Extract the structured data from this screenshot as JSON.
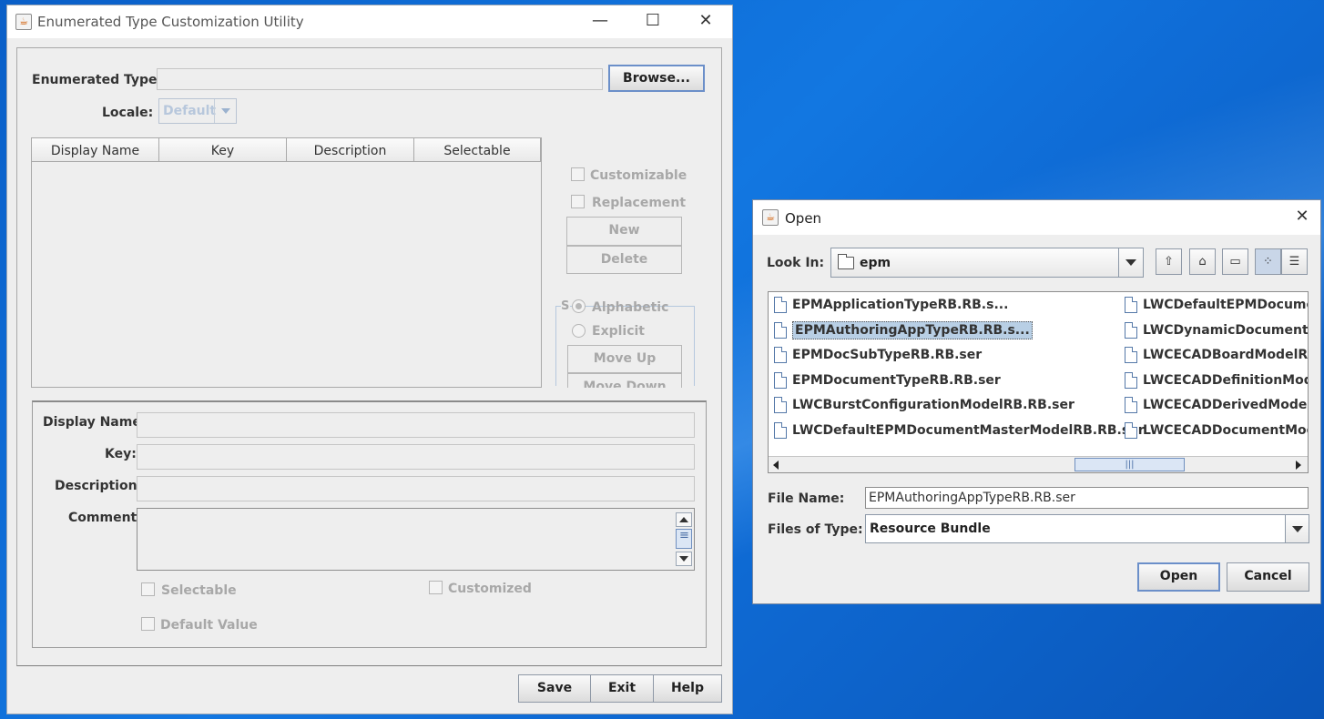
{
  "main_window": {
    "title": "Enumerated Type Customization Utility",
    "enumerated_type_label": "Enumerated Type:",
    "enumerated_type_value": "",
    "browse_label": "Browse...",
    "locale_label": "Locale:",
    "locale_value": "Default",
    "table_headers": [
      "Display Name",
      "Key",
      "Description",
      "Selectable"
    ],
    "customizable_label": "Customizable",
    "replacement_label": "Replacement",
    "new_label": "New",
    "delete_label": "Delete",
    "sort_group_label": "S",
    "alphabetic_label": "Alphabetic",
    "explicit_label": "Explicit",
    "move_up_label": "Move Up",
    "move_down_label": "Move Down",
    "display_name_label": "Display Name:",
    "key_label": "Key:",
    "description_label": "Description:",
    "comment_label": "Comment:",
    "selectable_label": "Selectable",
    "customized_label": "Customized",
    "default_value_label": "Default Value",
    "save_label": "Save",
    "exit_label": "Exit",
    "help_label": "Help"
  },
  "open_dialog": {
    "title": "Open",
    "look_in_label": "Look In:",
    "look_in_value": "epm",
    "files_col1": [
      "EPMApplicationTypeRB.RB.s...",
      "EPMAuthoringAppTypeRB.RB.s...",
      "EPMDocSubTypeRB.RB.ser",
      "EPMDocumentTypeRB.RB.ser",
      "LWCBurstConfigurationModelRB.RB.ser",
      "LWCDefaultEPMDocumentMasterModelRB.RB.ser"
    ],
    "files_col2": [
      "LWCDefaultEPMDocumer",
      "LWCDynamicDocumentMc",
      "LWCECADBoardModelRB",
      "LWCECADDefinitionMode",
      "LWCECADDerivedModelF",
      "LWCECADDocumentMode"
    ],
    "selected_file": "EPMAuthoringAppTypeRB.RB.s...",
    "file_name_label": "File Name:",
    "file_name_value": "EPMAuthoringAppTypeRB.RB.ser",
    "files_of_type_label": "Files of Type:",
    "files_of_type_value": "Resource Bundle",
    "open_label": "Open",
    "cancel_label": "Cancel"
  },
  "icons": [
    "java-app-icon",
    "minimize-icon",
    "maximize-icon",
    "close-icon",
    "folder-icon",
    "up-folder-icon",
    "home-icon",
    "new-folder-icon",
    "list-view-icon",
    "details-view-icon",
    "file-icon"
  ]
}
